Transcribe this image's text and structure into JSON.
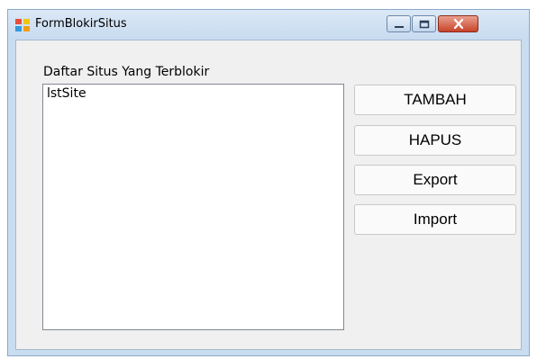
{
  "window": {
    "title": "FormBlokirSitus",
    "icons": {
      "app": "form-icon",
      "minimize": "minimize-icon",
      "maximize": "maximize-icon",
      "close": "close-icon"
    }
  },
  "list": {
    "label": "Daftar Situs Yang Terblokir",
    "items": [
      "lstSite"
    ]
  },
  "buttons": {
    "add": "TAMBAH",
    "delete": "HAPUS",
    "export": "Export",
    "import": "Import"
  },
  "colors": {
    "titlebar": "#c7dbf0",
    "client_bg": "#f0f0f0",
    "close_button": "#c8442a"
  }
}
